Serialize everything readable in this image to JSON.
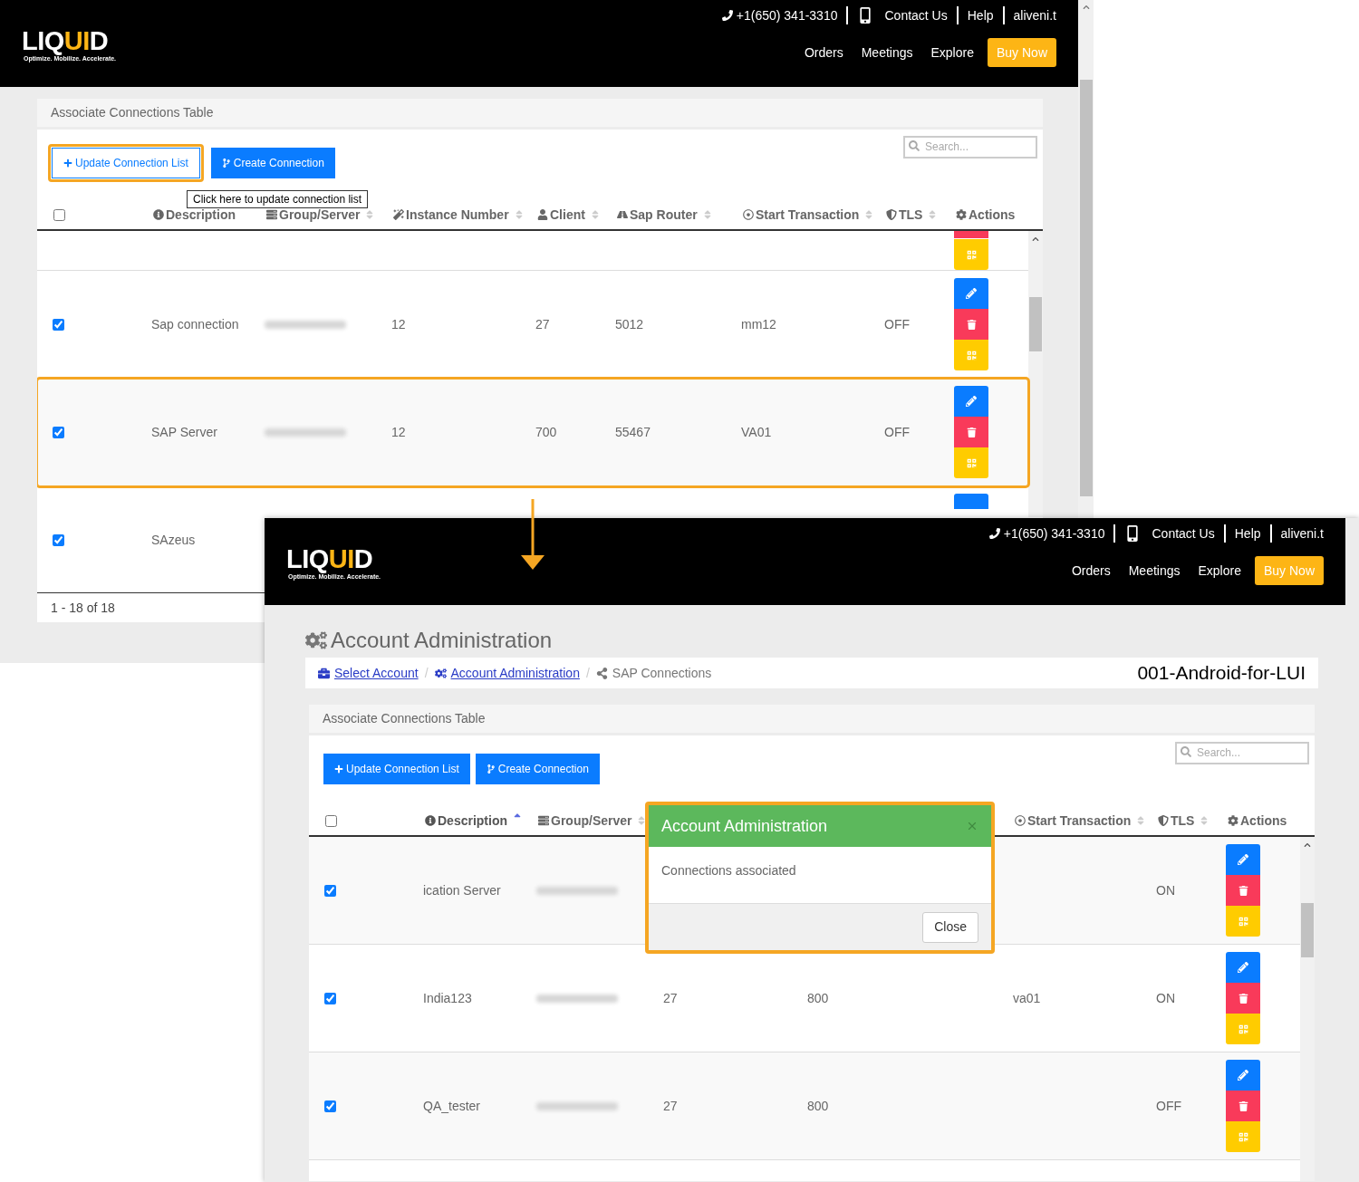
{
  "top_screen": {
    "header": {
      "logo": {
        "start": "LIQ",
        "accent": "UI",
        "end": "D",
        "tagline": "Optimize. Mobilize. Accelerate."
      },
      "phone": "+1(650) 341-3310",
      "contact": "Contact Us",
      "help": "Help",
      "user": "aliveni.t",
      "nav": [
        "Orders",
        "Meetings",
        "Explore"
      ],
      "cta": "Buy Now"
    },
    "card": {
      "title": "Associate Connections Table",
      "buttons": [
        {
          "label": "Update Connection List",
          "kind": "update",
          "highlighted": true
        },
        {
          "label": "Create Connection",
          "kind": "create",
          "highlighted": false
        }
      ],
      "search": {
        "placeholder": "Search..."
      },
      "header_checkbox": {
        "checked": false
      },
      "columns": [
        {
          "label": "Description",
          "sortable": false,
          "sorted": false
        },
        {
          "label": "Group/Server",
          "sortable": true,
          "sorted": false
        },
        {
          "label": "Instance Number",
          "sortable": true,
          "sorted": false
        },
        {
          "label": "Client",
          "sortable": true,
          "sorted": false
        },
        {
          "label": "Sap Router",
          "sortable": true,
          "sorted": false
        },
        {
          "label": "Start Transaction",
          "sortable": true,
          "sorted": false
        },
        {
          "label": "TLS",
          "sortable": true,
          "sorted": false
        },
        {
          "label": "Actions",
          "sortable": false,
          "sorted": false
        }
      ],
      "rows": [
        {
          "kind": "partial"
        },
        {
          "kind": "full",
          "checked": true,
          "highlighted": false,
          "description": "Sap connection",
          "instance": "12",
          "client": "27",
          "router": "5012",
          "start_transaction": "mm12",
          "tls": "OFF"
        },
        {
          "kind": "full",
          "checked": true,
          "highlighted": true,
          "description": "SAP Server",
          "instance": "12",
          "client": "700",
          "router": "55467",
          "start_transaction": "VA01",
          "tls": "OFF"
        },
        {
          "kind": "full",
          "checked": true,
          "highlighted": false,
          "description": "SAzeus"
        }
      ],
      "pagination": "1 - 18 of 18"
    },
    "tooltip": "Click here to update connection list"
  },
  "bottom_screen": {
    "header": {
      "logo": {
        "start": "LIQ",
        "accent": "UI",
        "end": "D",
        "tagline": "Optimize. Mobilize. Accelerate."
      },
      "phone": "+1(650) 341-3310",
      "contact": "Contact Us",
      "help": "Help",
      "user": "aliveni.t",
      "nav": [
        "Orders",
        "Meetings",
        "Explore"
      ],
      "cta": "Buy Now"
    },
    "page_title": "Account Administration",
    "breadcrumb": {
      "separator": "/",
      "items": [
        {
          "label": "Select Account",
          "link": true
        },
        {
          "label": "Account Administration",
          "link": true
        },
        {
          "label": "SAP Connections",
          "link": false
        }
      ],
      "account": "001-Android-for-LUI"
    },
    "card": {
      "title": "Associate Connections Table",
      "buttons": [
        {
          "label": "Update Connection List",
          "kind": "update",
          "highlighted": false
        },
        {
          "label": "Create Connection",
          "kind": "create",
          "highlighted": false
        }
      ],
      "search": {
        "placeholder": "Search..."
      },
      "header_checkbox": {
        "checked": false
      },
      "columns": [
        {
          "label": "Description",
          "sortable": true,
          "sorted": true
        },
        {
          "label": "Group/Server",
          "sortable": true,
          "sorted": false
        },
        {
          "label": "Start Transaction",
          "sortable": true,
          "sorted": false
        },
        {
          "label": "TLS",
          "sortable": true,
          "sorted": false
        },
        {
          "label": "Actions",
          "sortable": false,
          "sorted": false
        }
      ],
      "rows": [
        {
          "kind": "full",
          "checked": true,
          "highlighted": false,
          "description": "ication Server",
          "tls": "ON"
        },
        {
          "kind": "full",
          "checked": true,
          "highlighted": false,
          "description": "India123",
          "instance": "27",
          "client": "800",
          "start_transaction": "va01",
          "tls": "ON"
        },
        {
          "kind": "full",
          "checked": true,
          "highlighted": false,
          "description": "QA_tester",
          "instance": "27",
          "client": "800",
          "tls": "OFF"
        }
      ]
    },
    "modal": {
      "title": "Account Administration",
      "message": "Connections associated",
      "close_button": "Close",
      "highlighted": true
    }
  }
}
